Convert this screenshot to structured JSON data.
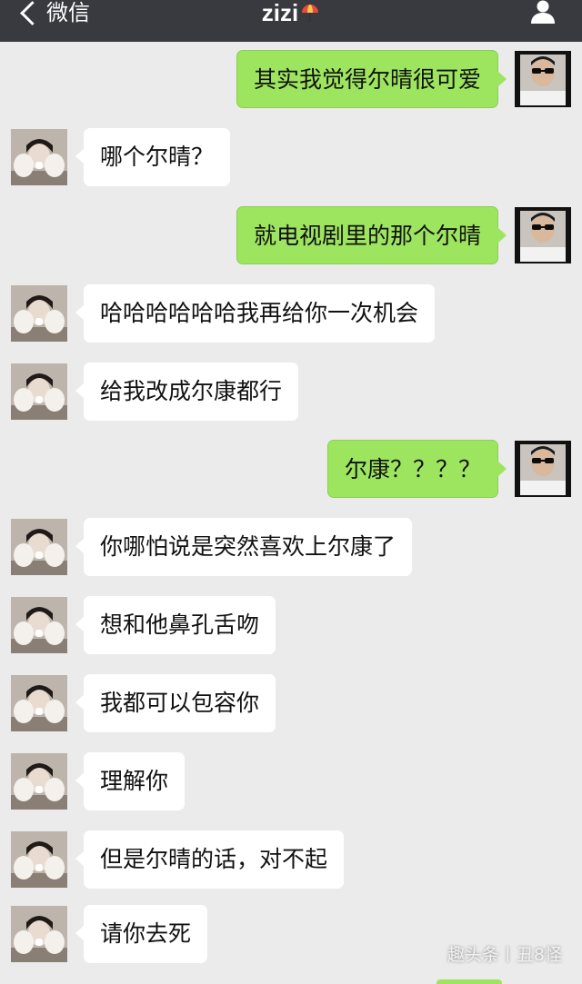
{
  "header": {
    "back_label": "微信",
    "title": "zizi",
    "title_icon": "umbrella-emoji-icon",
    "right_icon": "profile-icon"
  },
  "colors": {
    "header_bg": "#393a3f",
    "chat_bg": "#ebebeb",
    "outgoing_bubble": "#9ee55f",
    "incoming_bubble": "#ffffff"
  },
  "messages": [
    {
      "from": "me",
      "text": "其实我觉得尔晴很可爱"
    },
    {
      "from": "other",
      "text": "哪个尔晴？"
    },
    {
      "from": "me",
      "text": "就电视剧里的那个尔晴"
    },
    {
      "from": "other",
      "text": "哈哈哈哈哈哈我再给你一次机会"
    },
    {
      "from": "other",
      "text": "给我改成尔康都行"
    },
    {
      "from": "me",
      "text": "尔康？？？？"
    },
    {
      "from": "other",
      "text": "你哪怕说是突然喜欢上尔康了"
    },
    {
      "from": "other",
      "text": "想和他鼻孔舌吻"
    },
    {
      "from": "other",
      "text": "我都可以包容你"
    },
    {
      "from": "other",
      "text": "理解你"
    },
    {
      "from": "other",
      "text": "但是尔晴的话，对不起"
    },
    {
      "from": "other",
      "text": "请你去死"
    }
  ],
  "watermark": "趣头条丨丑8怪"
}
